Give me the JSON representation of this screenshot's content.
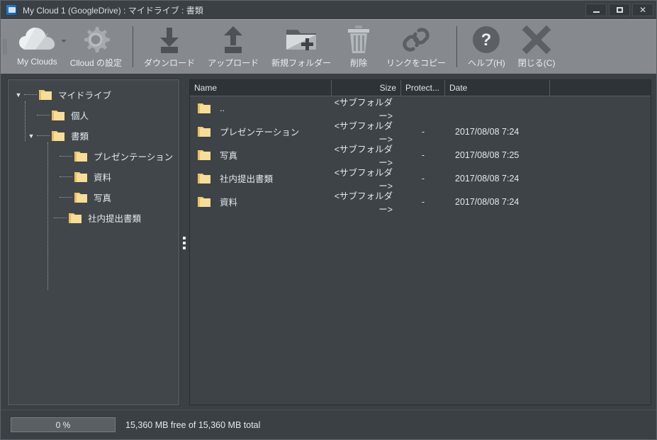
{
  "window": {
    "title": "My Cloud 1 (GoogleDrive) : マイドライブ : 書類",
    "app_icon": "cloud-monitor-icon",
    "controls": {
      "minimize": "minimize-icon",
      "maximize": "maximize-icon",
      "close": "close-icon"
    }
  },
  "toolbar": {
    "items": [
      {
        "label": "My Clouds",
        "icon": "cloud-icon",
        "has_dropdown": true
      },
      {
        "label": "Clloud の設定",
        "icon": "gear-icon",
        "has_dropdown": false
      },
      {
        "label": "ダウンロード",
        "icon": "download-icon",
        "has_dropdown": false
      },
      {
        "label": "アップロード",
        "icon": "upload-icon",
        "has_dropdown": false
      },
      {
        "label": "新規フォルダー",
        "icon": "new-folder-icon",
        "has_dropdown": false
      },
      {
        "label": "削除",
        "icon": "trash-icon",
        "has_dropdown": false
      },
      {
        "label": "リンクをコピー",
        "icon": "link-icon",
        "has_dropdown": false
      },
      {
        "label": "ヘルプ(H)",
        "icon": "help-icon",
        "has_dropdown": false
      },
      {
        "label": "閉じる(C)",
        "icon": "close-x-icon",
        "has_dropdown": false
      }
    ]
  },
  "tree": {
    "nodes": [
      {
        "label": "マイドライブ",
        "level": 0,
        "expanded": true,
        "has_twisty": true
      },
      {
        "label": "個人",
        "level": 1,
        "expanded": false,
        "has_twisty": false
      },
      {
        "label": "書類",
        "level": 1,
        "expanded": true,
        "has_twisty": true
      },
      {
        "label": "プレゼンテーション",
        "level": 2,
        "expanded": false,
        "has_twisty": false
      },
      {
        "label": "資料",
        "level": 2,
        "expanded": false,
        "has_twisty": false
      },
      {
        "label": "写真",
        "level": 2,
        "expanded": false,
        "has_twisty": false
      },
      {
        "label": "社内提出書類",
        "level": 2,
        "expanded": false,
        "has_twisty": false
      }
    ]
  },
  "list": {
    "columns": [
      "Name",
      "Size",
      "Protect...",
      "Date",
      ""
    ],
    "rows": [
      {
        "name": "..",
        "size": "<サブフォルダー>",
        "protect": "",
        "date": ""
      },
      {
        "name": "プレゼンテーション",
        "size": "<サブフォルダー>",
        "protect": "-",
        "date": "2017/08/08 7:24"
      },
      {
        "name": "写真",
        "size": "<サブフォルダー>",
        "protect": "-",
        "date": "2017/08/08 7:25"
      },
      {
        "name": "社内提出書類",
        "size": "<サブフォルダー>",
        "protect": "-",
        "date": "2017/08/08 7:24"
      },
      {
        "name": "資料",
        "size": "<サブフォルダー>",
        "protect": "-",
        "date": "2017/08/08 7:24"
      }
    ]
  },
  "status": {
    "progress_label": "0 %",
    "progress_percent": 0,
    "capacity_text": "15,360 MB free of 15,360 MB total"
  },
  "colors": {
    "window_bg": "#3b4045",
    "toolbar_bg": "#868a8e",
    "panel_bg": "#41464b",
    "list_bg": "#3e4348",
    "header_bg": "#2e3338",
    "folder_yellow": "#f5d07a",
    "text": "#e4e8eb"
  }
}
